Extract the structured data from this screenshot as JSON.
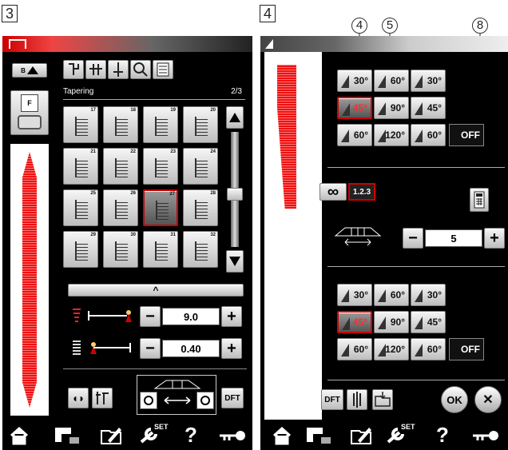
{
  "panels": {
    "left": "3",
    "right": "4"
  },
  "callouts": {
    "c4": "4",
    "c5": "5",
    "c8": "8"
  },
  "left": {
    "title": "Tapering",
    "page": "2/3",
    "patterns": [
      "17",
      "18",
      "19",
      "20",
      "21",
      "22",
      "23",
      "24",
      "25",
      "26",
      "27",
      "28",
      "29",
      "30",
      "31",
      "32"
    ],
    "width_value": "9.0",
    "length_value": "0.40",
    "minus": "−",
    "plus": "+",
    "dft": "DFT",
    "foot": "F",
    "b": "B",
    "chevron": "^"
  },
  "right": {
    "start_angles": [
      "30°",
      "60°",
      "30°",
      "45°",
      "90°",
      "45°",
      "60°",
      "120°",
      "60°"
    ],
    "end_angles": [
      "30°",
      "60°",
      "30°",
      "45°",
      "90°",
      "45°",
      "60°",
      "120°",
      "60°"
    ],
    "off": "OFF",
    "infinity": "∞",
    "counter": "1.2.3",
    "repeat_value": "5",
    "minus": "−",
    "plus": "+",
    "dft": "DFT",
    "ok": "OK",
    "close": "✕"
  },
  "bottom_bar": {
    "set": "SET",
    "help": "?"
  }
}
